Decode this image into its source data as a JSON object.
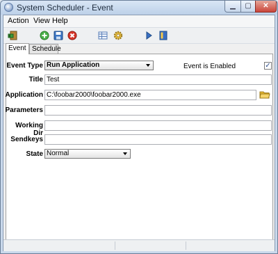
{
  "window": {
    "title": "System Scheduler - Event"
  },
  "menu": {
    "items": [
      "Action",
      "View",
      "Help"
    ]
  },
  "toolbar": {
    "buttons": [
      "exit-icon",
      "add-icon",
      "save-icon",
      "delete-icon",
      "table-icon",
      "settings-icon",
      "run-icon",
      "book-icon"
    ]
  },
  "tabs": {
    "event": "Event",
    "schedule": "Schedule"
  },
  "form": {
    "event_type_label": "Event Type",
    "event_type_value": "Run Application",
    "enabled_label": "Event is Enabled",
    "enabled_checked": true,
    "title_label": "Title",
    "title_value": "Test",
    "application_label": "Application",
    "application_value": "C:\\foobar2000\\foobar2000.exe",
    "parameters_label": "Parameters",
    "parameters_value": "",
    "working_dir_label": "Working Dir",
    "working_dir_value": "",
    "sendkeys_label": "Sendkeys",
    "sendkeys_value": "",
    "state_label": "State",
    "state_value": "Normal"
  },
  "colors": {
    "title_bar": "#c9d9ec",
    "close_button": "#c9453a",
    "folder_icon": "#e8b830"
  }
}
